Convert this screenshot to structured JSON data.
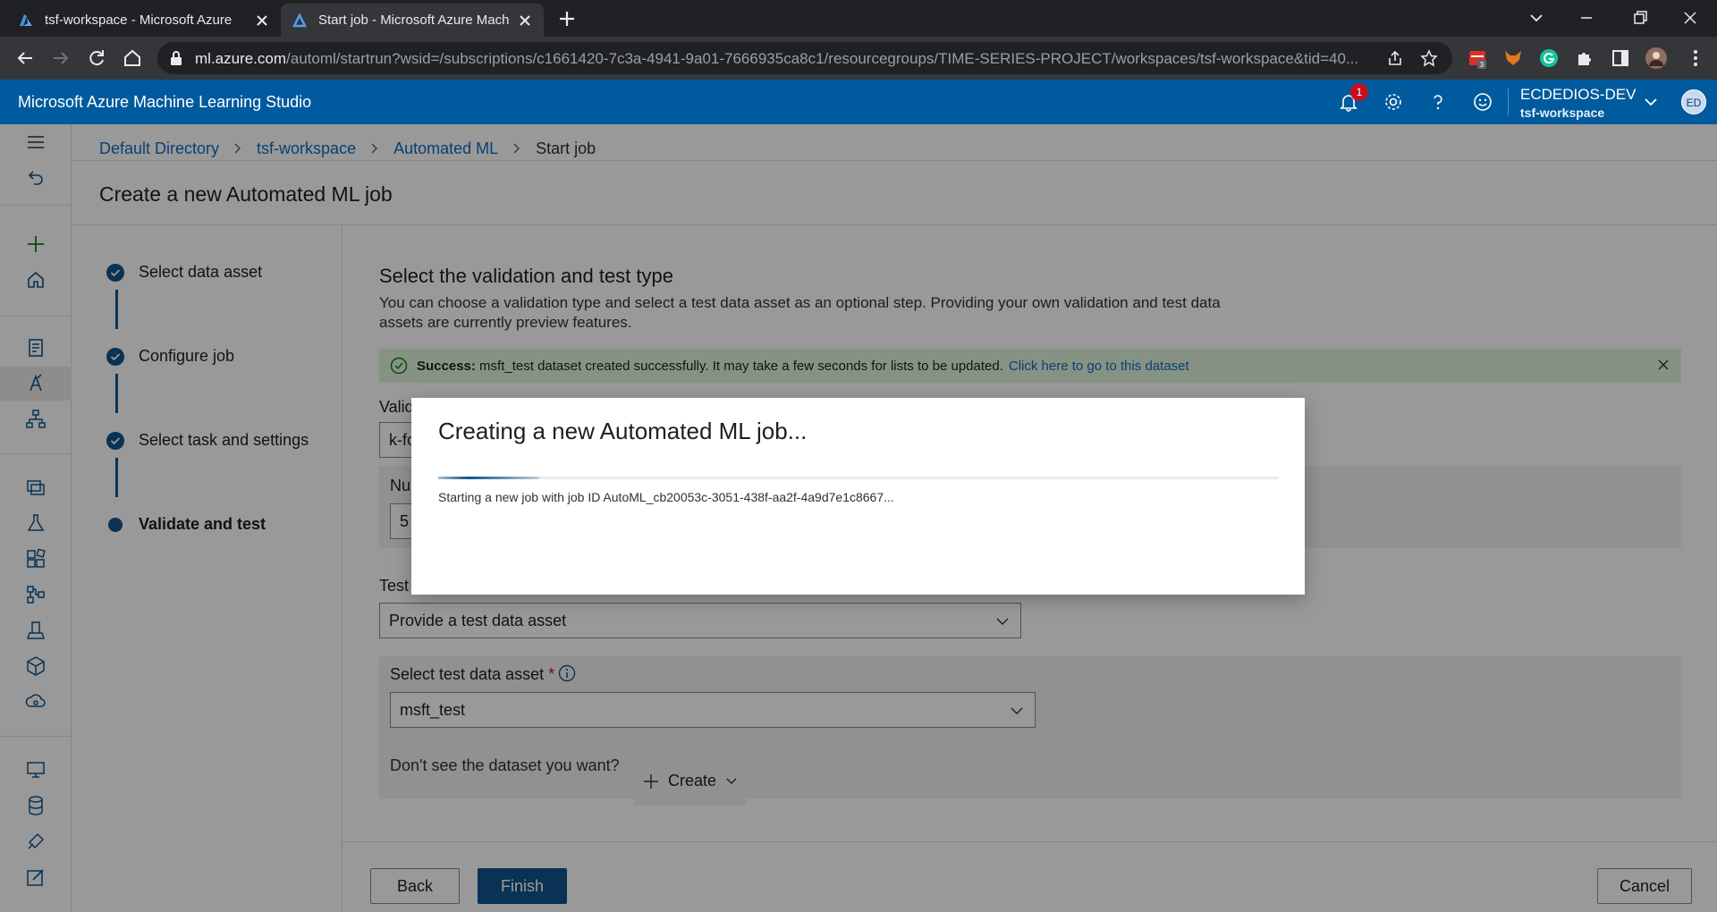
{
  "browser": {
    "tabs": [
      {
        "title": "tsf-workspace - Microsoft Azure",
        "active": false
      },
      {
        "title": "Start job - Microsoft Azure Machine Learning Studio",
        "active": true
      }
    ],
    "url_host": "ml.azure.com",
    "url_rest": "/automl/startrun?wsid=/subscriptions/c1661420-7c3a-4941-9a01-7666935ca8c1/resourcegroups/TIME-SERIES-PROJECT/workspaces/tsf-workspace&tid=40...",
    "extension_badge": "3"
  },
  "header": {
    "brand": "Microsoft Azure Machine Learning Studio",
    "notification_count": "1",
    "account_name": "ECDEDIOS-DEV",
    "workspace": "tsf-workspace",
    "avatar_initials": "ED"
  },
  "breadcrumbs": [
    "Default Directory",
    "tsf-workspace",
    "Automated ML",
    "Start job"
  ],
  "page_title": "Create a new Automated ML job",
  "steps": [
    {
      "label": "Select data asset",
      "state": "done"
    },
    {
      "label": "Configure job",
      "state": "done"
    },
    {
      "label": "Select task and settings",
      "state": "done"
    },
    {
      "label": "Validate and test",
      "state": "current"
    }
  ],
  "section": {
    "title": "Select the validation and test type",
    "description": "You can choose a validation type and select a test data asset as an optional step. Providing your own validation and test data assets are currently preview features."
  },
  "message": {
    "prefix": "Success:",
    "text": "msft_test dataset created successfully. It may take a few seconds for lists to be updated.",
    "link": "Click here to go to this dataset"
  },
  "form": {
    "validation_label": "Valid",
    "validation_value": "k-fo",
    "number_label": "Nu",
    "number_value": "5",
    "test_label": "Test",
    "test_value": "Provide a test data asset",
    "test_asset_label": "Select test data asset",
    "required_mark": "*",
    "test_asset_value": "msft_test",
    "dataset_question": "Don't see the dataset you want?",
    "create_label": "Create"
  },
  "footer": {
    "back": "Back",
    "finish": "Finish",
    "cancel": "Cancel"
  },
  "modal": {
    "title": "Creating a new Automated ML job...",
    "status": "Starting a new job with job ID AutoML_cb20053c-3051-438f-aa2f-4a9d7e1c8667...",
    "progress": 0.12
  },
  "colors": {
    "accent": "#0f548c",
    "header_bg": "#005a9e",
    "success_bg": "#dff6dd"
  }
}
